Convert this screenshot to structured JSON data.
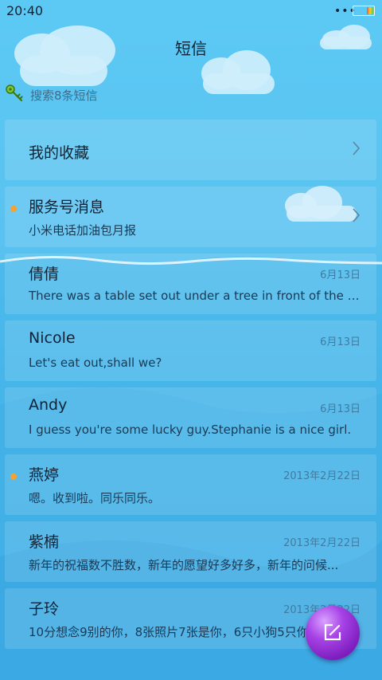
{
  "status_bar": {
    "time": "20:40",
    "more_dots": "•••"
  },
  "header": {
    "title": "短信"
  },
  "search": {
    "placeholder": "搜索8条短信",
    "icon": "key-icon"
  },
  "favorites": {
    "label": "我的收藏"
  },
  "service": {
    "name": "服务号消息",
    "preview": "小米电话加油包月报"
  },
  "conversations": [
    {
      "name": "倩倩",
      "preview": "There was a table set out under a tree in front of the ho...",
      "date": "6月13日",
      "unread": false
    },
    {
      "name": "Nicole",
      "preview": "Let's eat out,shall we?",
      "date": "6月13日",
      "unread": false
    },
    {
      "name": "Andy",
      "preview": "I guess you're some lucky guy.Stephanie is a nice girl.",
      "date": "6月13日",
      "unread": false
    },
    {
      "name": "燕婷",
      "preview": "嗯。收到啦。同乐同乐。",
      "date": "2013年2月22日",
      "unread": true
    },
    {
      "name": "紫楠",
      "preview": "新年的祝福数不胜数，新年的愿望好多好多，新年的问候...",
      "date": "2013年2月22日",
      "unread": false
    },
    {
      "name": "子玲",
      "preview": "10分想念9别的你，8张照片7张是你，6只小狗5只你...",
      "date": "2013年2月22日",
      "unread": false
    }
  ],
  "colors": {
    "unread_dot": "#f4a32f",
    "fab": "#8e2bd0",
    "background": "#59c2f0"
  },
  "fab": {
    "icon": "compose-icon"
  }
}
